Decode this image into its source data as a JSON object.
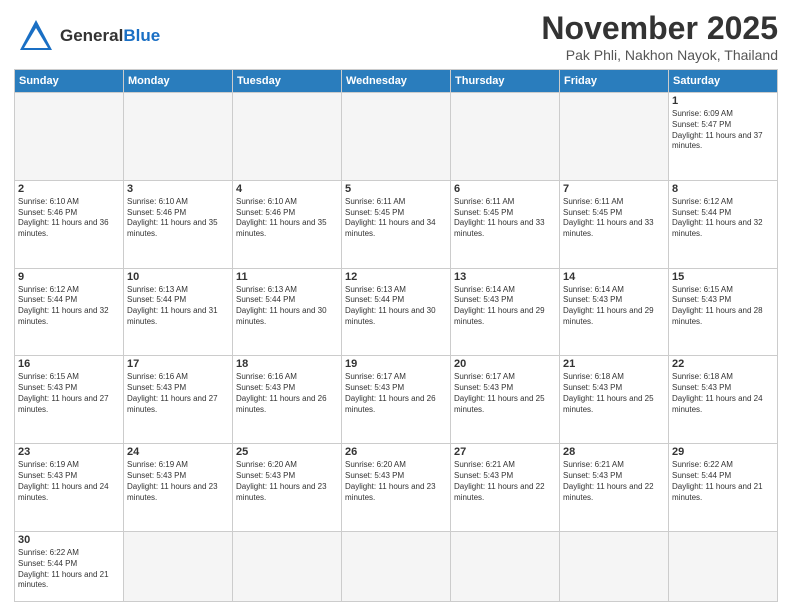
{
  "header": {
    "logo_text_normal": "General",
    "logo_text_colored": "Blue",
    "month_title": "November 2025",
    "location": "Pak Phli, Nakhon Nayok, Thailand"
  },
  "weekdays": [
    "Sunday",
    "Monday",
    "Tuesday",
    "Wednesday",
    "Thursday",
    "Friday",
    "Saturday"
  ],
  "weeks": [
    [
      {
        "day": "",
        "empty": true
      },
      {
        "day": "",
        "empty": true
      },
      {
        "day": "",
        "empty": true
      },
      {
        "day": "",
        "empty": true
      },
      {
        "day": "",
        "empty": true
      },
      {
        "day": "",
        "empty": true
      },
      {
        "day": "1",
        "sunrise": "6:09 AM",
        "sunset": "5:47 PM",
        "daylight": "11 hours and 37 minutes."
      }
    ],
    [
      {
        "day": "2",
        "sunrise": "6:10 AM",
        "sunset": "5:46 PM",
        "daylight": "11 hours and 36 minutes."
      },
      {
        "day": "3",
        "sunrise": "6:10 AM",
        "sunset": "5:46 PM",
        "daylight": "11 hours and 35 minutes."
      },
      {
        "day": "4",
        "sunrise": "6:10 AM",
        "sunset": "5:46 PM",
        "daylight": "11 hours and 35 minutes."
      },
      {
        "day": "5",
        "sunrise": "6:11 AM",
        "sunset": "5:45 PM",
        "daylight": "11 hours and 34 minutes."
      },
      {
        "day": "6",
        "sunrise": "6:11 AM",
        "sunset": "5:45 PM",
        "daylight": "11 hours and 33 minutes."
      },
      {
        "day": "7",
        "sunrise": "6:11 AM",
        "sunset": "5:45 PM",
        "daylight": "11 hours and 33 minutes."
      },
      {
        "day": "8",
        "sunrise": "6:12 AM",
        "sunset": "5:44 PM",
        "daylight": "11 hours and 32 minutes."
      }
    ],
    [
      {
        "day": "9",
        "sunrise": "6:12 AM",
        "sunset": "5:44 PM",
        "daylight": "11 hours and 32 minutes."
      },
      {
        "day": "10",
        "sunrise": "6:13 AM",
        "sunset": "5:44 PM",
        "daylight": "11 hours and 31 minutes."
      },
      {
        "day": "11",
        "sunrise": "6:13 AM",
        "sunset": "5:44 PM",
        "daylight": "11 hours and 30 minutes."
      },
      {
        "day": "12",
        "sunrise": "6:13 AM",
        "sunset": "5:44 PM",
        "daylight": "11 hours and 30 minutes."
      },
      {
        "day": "13",
        "sunrise": "6:14 AM",
        "sunset": "5:43 PM",
        "daylight": "11 hours and 29 minutes."
      },
      {
        "day": "14",
        "sunrise": "6:14 AM",
        "sunset": "5:43 PM",
        "daylight": "11 hours and 29 minutes."
      },
      {
        "day": "15",
        "sunrise": "6:15 AM",
        "sunset": "5:43 PM",
        "daylight": "11 hours and 28 minutes."
      }
    ],
    [
      {
        "day": "16",
        "sunrise": "6:15 AM",
        "sunset": "5:43 PM",
        "daylight": "11 hours and 27 minutes."
      },
      {
        "day": "17",
        "sunrise": "6:16 AM",
        "sunset": "5:43 PM",
        "daylight": "11 hours and 27 minutes."
      },
      {
        "day": "18",
        "sunrise": "6:16 AM",
        "sunset": "5:43 PM",
        "daylight": "11 hours and 26 minutes."
      },
      {
        "day": "19",
        "sunrise": "6:17 AM",
        "sunset": "5:43 PM",
        "daylight": "11 hours and 26 minutes."
      },
      {
        "day": "20",
        "sunrise": "6:17 AM",
        "sunset": "5:43 PM",
        "daylight": "11 hours and 25 minutes."
      },
      {
        "day": "21",
        "sunrise": "6:18 AM",
        "sunset": "5:43 PM",
        "daylight": "11 hours and 25 minutes."
      },
      {
        "day": "22",
        "sunrise": "6:18 AM",
        "sunset": "5:43 PM",
        "daylight": "11 hours and 24 minutes."
      }
    ],
    [
      {
        "day": "23",
        "sunrise": "6:19 AM",
        "sunset": "5:43 PM",
        "daylight": "11 hours and 24 minutes."
      },
      {
        "day": "24",
        "sunrise": "6:19 AM",
        "sunset": "5:43 PM",
        "daylight": "11 hours and 23 minutes."
      },
      {
        "day": "25",
        "sunrise": "6:20 AM",
        "sunset": "5:43 PM",
        "daylight": "11 hours and 23 minutes."
      },
      {
        "day": "26",
        "sunrise": "6:20 AM",
        "sunset": "5:43 PM",
        "daylight": "11 hours and 23 minutes."
      },
      {
        "day": "27",
        "sunrise": "6:21 AM",
        "sunset": "5:43 PM",
        "daylight": "11 hours and 22 minutes."
      },
      {
        "day": "28",
        "sunrise": "6:21 AM",
        "sunset": "5:43 PM",
        "daylight": "11 hours and 22 minutes."
      },
      {
        "day": "29",
        "sunrise": "6:22 AM",
        "sunset": "5:44 PM",
        "daylight": "11 hours and 21 minutes."
      }
    ],
    [
      {
        "day": "30",
        "sunrise": "6:22 AM",
        "sunset": "5:44 PM",
        "daylight": "11 hours and 21 minutes."
      },
      {
        "day": "",
        "empty": true
      },
      {
        "day": "",
        "empty": true
      },
      {
        "day": "",
        "empty": true
      },
      {
        "day": "",
        "empty": true
      },
      {
        "day": "",
        "empty": true
      },
      {
        "day": "",
        "empty": true
      }
    ]
  ],
  "labels": {
    "sunrise": "Sunrise:",
    "sunset": "Sunset:",
    "daylight": "Daylight:"
  }
}
